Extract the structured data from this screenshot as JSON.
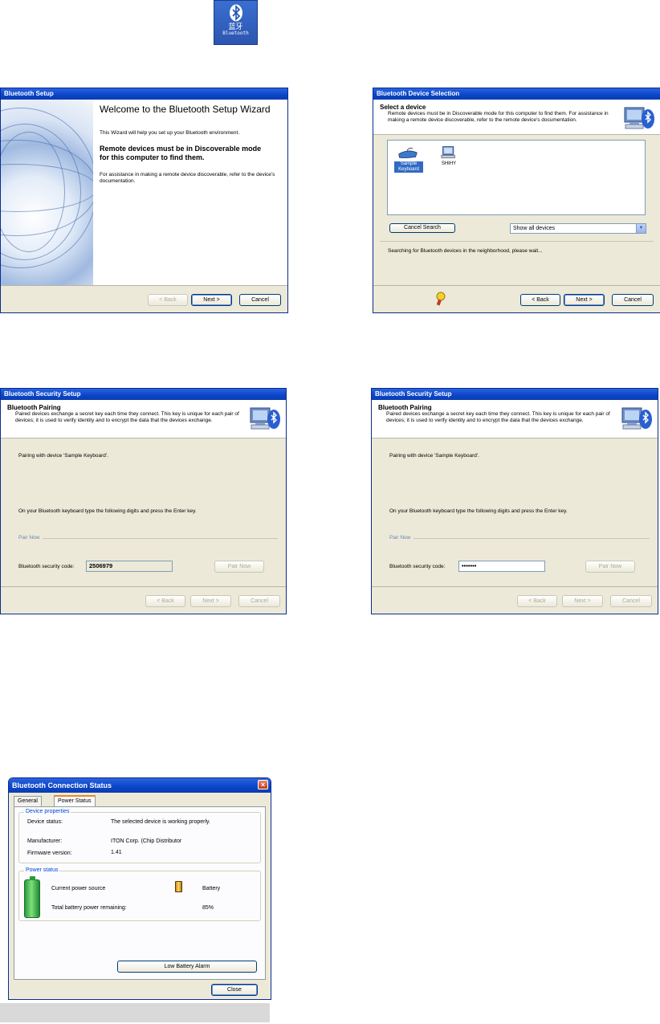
{
  "desktop_icon": {
    "chinese_label": "蓝牙",
    "label": "Bluetooth"
  },
  "setup_wizard": {
    "title": "Bluetooth Setup",
    "heading": "Welcome to the Bluetooth Setup Wizard",
    "intro": "This Wizard will help you set up your Bluetooth environment.",
    "note": "Remote devices must be in Discoverable mode for this computer to find them.",
    "assist": "For assistance in making a remote device discoverable, refer to the device's documentation.",
    "back_label": "< Back",
    "next_label": "Next >",
    "cancel_label": "Cancel"
  },
  "device_selection": {
    "title": "Bluetooth Device Selection",
    "header_title": "Select a device",
    "header_desc": "Remote devices must be in Discoverable mode for this computer to find them. For assistance in making a remote device discoverable, refer to the remote device's documentation.",
    "devices": [
      {
        "name": "Sample Keyboard"
      },
      {
        "name": "SHIHY"
      }
    ],
    "cancel_search_label": "Cancel Search",
    "filter_value": "Show all devices",
    "status_text": "Searching for Bluetooth devices in the neighborhood, please wait...",
    "back_label": "< Back",
    "next_label": "Next >",
    "cancel_label": "Cancel"
  },
  "security_setup": [
    {
      "title": "Bluetooth Security Setup",
      "header_title": "Bluetooth Pairing",
      "header_desc": "Paired devices exchange a secret key each time they connect. This key is unique for each pair of devices; it is used to verify identity and to encrypt the data that the devices exchange.",
      "pairing_text": "Pairing with device 'Sample Keyboard'.",
      "instruction": "On your Bluetooth keyboard type the following digits and press the Enter key.",
      "pair_now_link": "Pair Now",
      "code_label": "Bluetooth security code:",
      "code_value": "2506979",
      "pair_now_button": "Pair Now",
      "back_label": "< Back",
      "next_label": "Next >",
      "cancel_label": "Cancel"
    },
    {
      "title": "Bluetooth Security Setup",
      "header_title": "Bluetooth Pairing",
      "header_desc": "Paired devices exchange a secret key each time they connect. This key is unique for each pair of devices; it is used to verify identity and to encrypt the data that the devices exchange.",
      "pairing_text": "Pairing with device 'Sample Keyboard'.",
      "instruction": "On your Bluetooth keyboard type the following digits and press the Enter key.",
      "pair_now_link": "Pair Now",
      "code_label": "Bluetooth security code:",
      "code_value": "•••••••",
      "pair_now_button": "Pair Now",
      "back_label": "< Back",
      "next_label": "Next >",
      "cancel_label": "Cancel"
    }
  ],
  "connection_status": {
    "title": "Bluetooth Connection Status",
    "tabs": [
      "General",
      "Power Status"
    ],
    "active_tab": "Power Status",
    "device_properties_title": "Device properties",
    "device_status_label": "Device status:",
    "device_status_value": "The selected device is working properly.",
    "manufacturer_label": "Manufacturer:",
    "manufacturer_value": "ITON Corp. (Chip Distributor",
    "firmware_label": "Firmware version:",
    "firmware_value": "1.41",
    "power_status_title": "Power status",
    "power_source_label": "Current power source",
    "power_source_value": "Battery",
    "battery_label": "Total battery power remaining:",
    "battery_value": "85%",
    "alarm_button": "Low Battery Alarm",
    "close_button": "Close"
  },
  "colors": {
    "title_blue": "#0a45c8",
    "dialog_bg": "#ece9d8",
    "link_blue": "#0046d5",
    "battery_green": "#2a9a3c"
  }
}
